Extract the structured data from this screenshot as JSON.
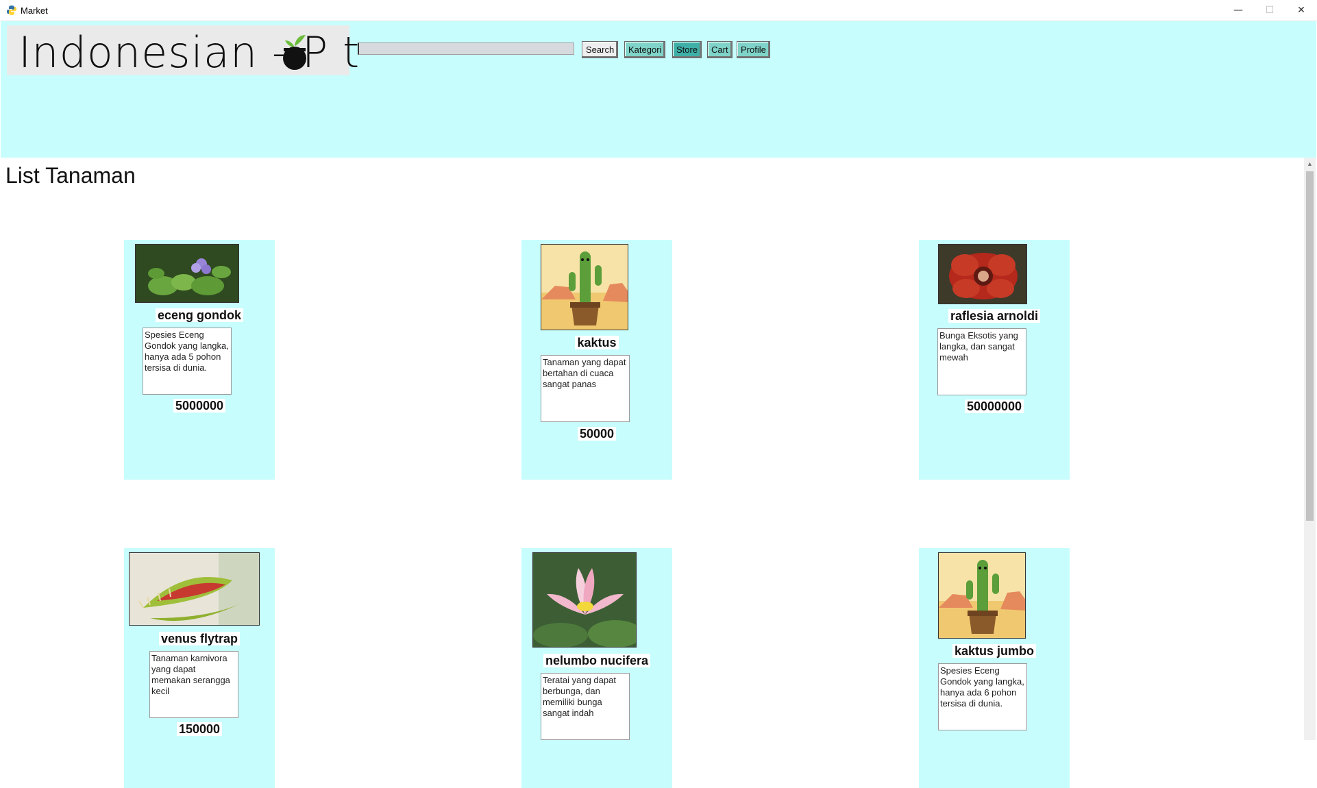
{
  "window": {
    "title": "Market"
  },
  "header": {
    "logo_text": "Indonesian - P  t",
    "search_placeholder": "",
    "buttons": [
      {
        "label": "Search"
      },
      {
        "label": "Kategori"
      },
      {
        "label": "Store"
      },
      {
        "label": "Cart"
      },
      {
        "label": "Profile"
      }
    ]
  },
  "main": {
    "title": "List Tanaman",
    "products": [
      {
        "name": "eceng gondok",
        "description": "Spesies Eceng Gondok yang langka, hanya ada 5 pohon tersisa di dunia.",
        "price": "5000000",
        "image": "water-hyacinth"
      },
      {
        "name": "kaktus",
        "description": "Tanaman yang dapat bertahan di cuaca sangat panas",
        "price": "50000",
        "image": "dancing-cactus"
      },
      {
        "name": "raflesia arnoldi",
        "description": "Bunga Eksotis yang langka, dan sangat mewah",
        "price": "50000000",
        "image": "rafflesia"
      },
      {
        "name": "venus flytrap",
        "description": "Tanaman karnivora yang dapat memakan serangga kecil",
        "price": "150000",
        "image": "venus-flytrap"
      },
      {
        "name": "nelumbo nucifera",
        "description": "Teratai yang dapat berbunga, dan memiliki bunga sangat indah",
        "price": "",
        "image": "lotus"
      },
      {
        "name": "kaktus jumbo",
        "description": "Spesies Eceng Gondok yang langka, hanya ada 6 pohon tersisa di dunia.",
        "price": "",
        "image": "dancing-cactus"
      }
    ]
  },
  "colors": {
    "header_bg": "#c8fdfd",
    "card_bg": "#c8fdfd",
    "store_button": "#3fb0a8",
    "nav_button": "#7fd3c8"
  }
}
